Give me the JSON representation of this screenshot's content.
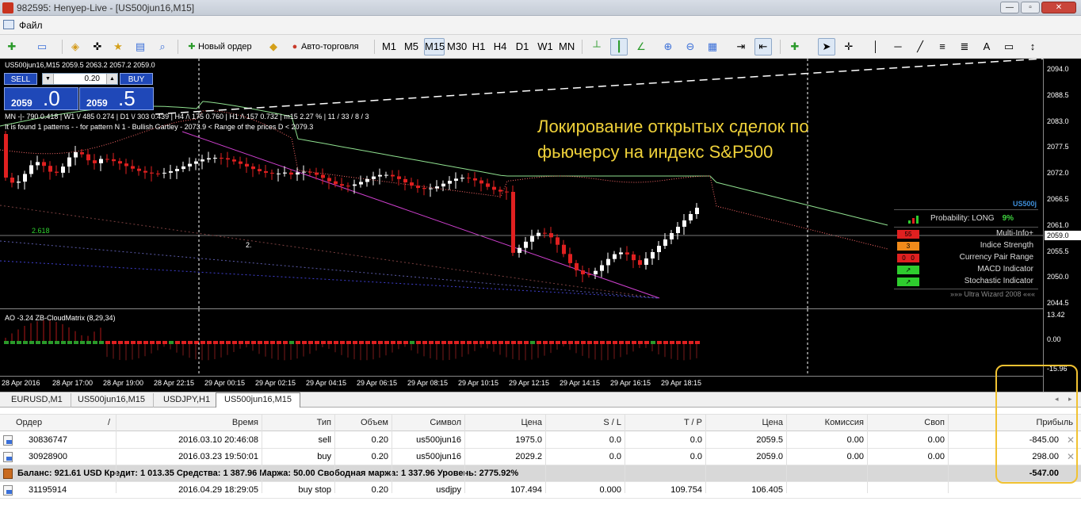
{
  "window": {
    "title": "982595: Henyep-Live - [US500jun16,M15]",
    "controls": [
      "—",
      "▫",
      "✕"
    ]
  },
  "menu": {
    "file": "Файл"
  },
  "toolbar": {
    "new_order": "Новый ордер",
    "auto_trading": "Авто-торговля",
    "timeframes": [
      "M1",
      "M5",
      "M15",
      "M30",
      "H1",
      "H4",
      "D1",
      "W1",
      "MN"
    ],
    "active_timeframe": "M15"
  },
  "chart": {
    "symbol_line": "US500jun16,M15  2059.5 2063.2 2057.2 2059.0",
    "mn_line": "MN -|- 790  0.418  |  W1 \\/ 485  0.274  |  D1 \\/ 303  0.439  |  H4 /\\ 175  0.760  |  H1 /\\ 157  0.732  |  m15  2.27 %  |  11 / 33 / 8 / 3",
    "pattern_line": "It is found 1 patterns -  - for pattern N 1 - Bullish Gartley - 2073.9 < Range of the prices D < 2079.3",
    "fib_label": "2.618",
    "point_label": "2.",
    "headline_1": "Локирование открытых сделок по",
    "headline_2": "фьючерсу на индекс S&P500",
    "indicator_label": "AO -3.24  ZB-CloudMatrix (8,29,34)",
    "price_labels": [
      "2094.0",
      "2088.5",
      "2083.0",
      "2077.5",
      "2072.0",
      "2066.5",
      "2061.0",
      "2055.5",
      "2050.0",
      "2044.5"
    ],
    "current_price": "2059.0",
    "indicator_labels": [
      "13.42",
      "0.00",
      "-15.96"
    ],
    "time_labels": [
      "28 Apr 2016",
      "28 Apr 17:00",
      "28 Apr 19:00",
      "28 Apr 22:15",
      "29 Apr 00:15",
      "29 Apr 02:15",
      "29 Apr 04:15",
      "29 Apr 06:15",
      "29 Apr 08:15",
      "29 Apr 10:15",
      "29 Apr 12:15",
      "29 Apr 14:15",
      "29 Apr 16:15",
      "29 Apr 18:15"
    ]
  },
  "oneclick": {
    "sell_label": "SELL",
    "buy_label": "BUY",
    "lot": "0.20",
    "sell_small": "2059",
    "sell_big": ".0",
    "buy_small": "2059",
    "buy_big": ".5"
  },
  "ultra_wizard": {
    "symbol": "US500j",
    "probability_label": "Probability:  LONG",
    "probability_value": "9%",
    "rows": [
      {
        "box": "55",
        "box_color": "#e02020",
        "name": "Multi-Info+"
      },
      {
        "box": "3",
        "box_color": "#f08a1a",
        "name": "Indice Strength"
      },
      {
        "box": "0   0",
        "box_color": "#e02020",
        "name": "Currency Pair Range"
      },
      {
        "box": "↗",
        "box_color": "#2ecc2e",
        "name": "MACD Indicator"
      },
      {
        "box": "↗",
        "box_color": "#2ecc2e",
        "name": "Stochastic Indicator"
      }
    ],
    "footer": "»»» Ultra Wizard 2008 «««"
  },
  "tabs": [
    "EURUSD,M1",
    "US500jun16,M15",
    "USDJPY,H1",
    "US500jun16,M15"
  ],
  "active_tab": 3,
  "table": {
    "headers": [
      "Ордер",
      "/",
      "Время",
      "Тип",
      "Объем",
      "Символ",
      "Цена",
      "S / L",
      "T / P",
      "Цена",
      "Комиссия",
      "Своп",
      "Прибыль"
    ],
    "rows": [
      [
        "30836747",
        "2016.03.10 20:46:08",
        "sell",
        "0.20",
        "us500jun16",
        "1975.0",
        "0.0",
        "0.0",
        "2059.5",
        "0.00",
        "0.00",
        "-845.00"
      ],
      [
        "30928900",
        "2016.03.23 19:50:01",
        "buy",
        "0.20",
        "us500jun16",
        "2029.2",
        "0.0",
        "0.0",
        "2059.0",
        "0.00",
        "0.00",
        "298.00"
      ]
    ],
    "balance": "Баланс: 921.61 USD   Кредит: 1 013.35   Средства: 1 387.96   Маржа: 50.00   Свободная маржа: 1 337.96   Уровень: 2775.92%",
    "balance_profit": "-547.00",
    "pending": [
      "31195914",
      "2016.04.29 18:29:05",
      "buy stop",
      "0.20",
      "usdjpy",
      "107.494",
      "0.000",
      "109.754",
      "106.405"
    ]
  },
  "colors": {
    "bull": "#ffffff",
    "bear": "#e02020",
    "cloud_up": "#8fe08f",
    "cloud_down": "#ff6b6b",
    "highlight": "#f1c232",
    "headline": "#f0d23a"
  }
}
